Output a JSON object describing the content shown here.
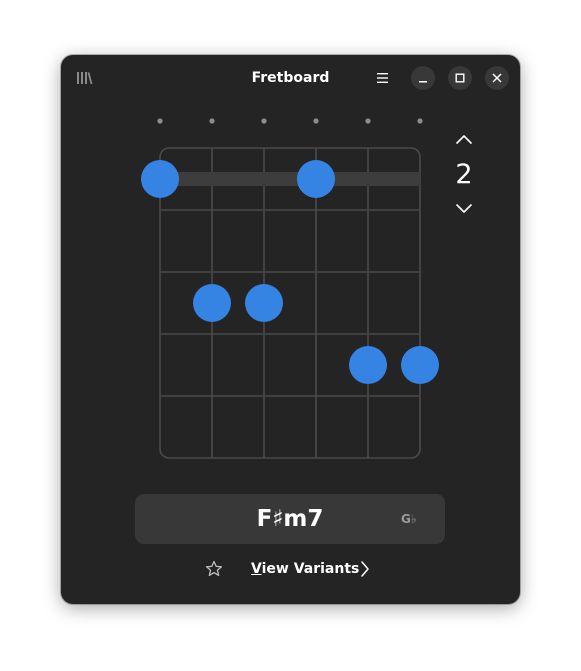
{
  "window": {
    "title": "Fretboard"
  },
  "fret": {
    "position": "2"
  },
  "chord": {
    "name": "F♯m7",
    "enharmonic": "G♭"
  },
  "footer": {
    "variants_label": "View Variants",
    "mnemonic": "V"
  },
  "diagram": {
    "strings": 6,
    "frets_shown": 5,
    "barre": {
      "fret": 1,
      "from_string": 1,
      "to_string": 6
    },
    "fingers": [
      {
        "string": 1,
        "fret": 1
      },
      {
        "string": 4,
        "fret": 1
      },
      {
        "string": 2,
        "fret": 3
      },
      {
        "string": 3,
        "fret": 3
      },
      {
        "string": 5,
        "fret": 4
      },
      {
        "string": 6,
        "fret": 4
      }
    ]
  },
  "colors": {
    "accent": "#3584e4",
    "window_bg": "#242424",
    "surface": "#383838",
    "grid": "#4a4a4a"
  },
  "icons": {
    "library": "library-icon",
    "menu": "hamburger-menu-icon",
    "minimize": "minimize-icon",
    "maximize": "maximize-icon",
    "close": "close-icon",
    "up": "chevron-up-icon",
    "down": "chevron-down-icon",
    "favorite": "star-icon",
    "next": "chevron-right-icon"
  }
}
